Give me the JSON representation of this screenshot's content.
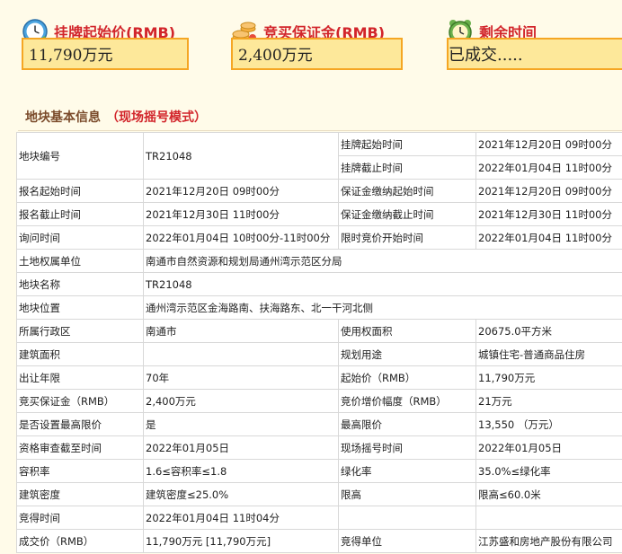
{
  "header": {
    "start_price": {
      "label": "挂牌起始价(RMB)",
      "value": "11,790万元"
    },
    "deposit": {
      "label": "竞买保证金(RMB)",
      "value": "2,400万元"
    },
    "remaining": {
      "label": "剩余时间",
      "value": "已成交....."
    }
  },
  "section": {
    "title": "地块基本信息",
    "mode": "（现场摇号模式）"
  },
  "rows": {
    "r1": [
      "地块编号",
      "TR21048",
      "挂牌起始时间",
      "2021年12月20日 09时00分"
    ],
    "r1b": [
      "挂牌截止时间",
      "2022年01月04日 11时00分"
    ],
    "r2": [
      "报名起始时间",
      "2021年12月20日 09时00分",
      "保证金缴纳起始时间",
      "2021年12月20日 09时00分"
    ],
    "r3": [
      "报名截止时间",
      "2021年12月30日 11时00分",
      "保证金缴纳截止时间",
      "2021年12月30日 11时00分"
    ],
    "r4": [
      "询问时间",
      "2022年01月04日 10时00分-11时00分",
      "限时竞价开始时间",
      "2022年01月04日 11时00分"
    ],
    "r5": [
      "土地权属单位",
      "南通市自然资源和规划局通州湾示范区分局"
    ],
    "r6": [
      "地块名称",
      "TR21048"
    ],
    "r7": [
      "地块位置",
      "通州湾示范区金海路南、扶海路东、北一干河北侧"
    ],
    "r8": [
      "所属行政区",
      "南通市",
      "使用权面积",
      "20675.0平方米"
    ],
    "r9": [
      "建筑面积",
      "",
      "规划用途",
      "城镇住宅-普通商品住房"
    ],
    "r10": [
      "出让年限",
      "70年",
      "起始价（RMB）",
      "11,790万元"
    ],
    "r11": [
      "竞买保证金（RMB）",
      "2,400万元",
      "竞价增价幅度（RMB）",
      "21万元"
    ],
    "r12": [
      "是否设置最高限价",
      "是",
      "最高限价",
      "13,550 （万元）"
    ],
    "r13": [
      "资格审查截至时间",
      "2022年01月05日",
      "现场摇号时间",
      "2022年01月05日"
    ],
    "r14": [
      "容积率",
      "1.6≤容积率≤1.8",
      "绿化率",
      "35.0%≤绿化率"
    ],
    "r15": [
      "建筑密度",
      "建筑密度≤25.0%",
      "限高",
      "限高≤60.0米"
    ],
    "r16": [
      "竞得时间",
      "2022年01月04日 11时04分",
      "",
      ""
    ],
    "r17": [
      "成交价（RMB）",
      "11,790万元 [11,790万元]",
      "竞得单位",
      "江苏盛和房地产股份有限公司"
    ]
  }
}
